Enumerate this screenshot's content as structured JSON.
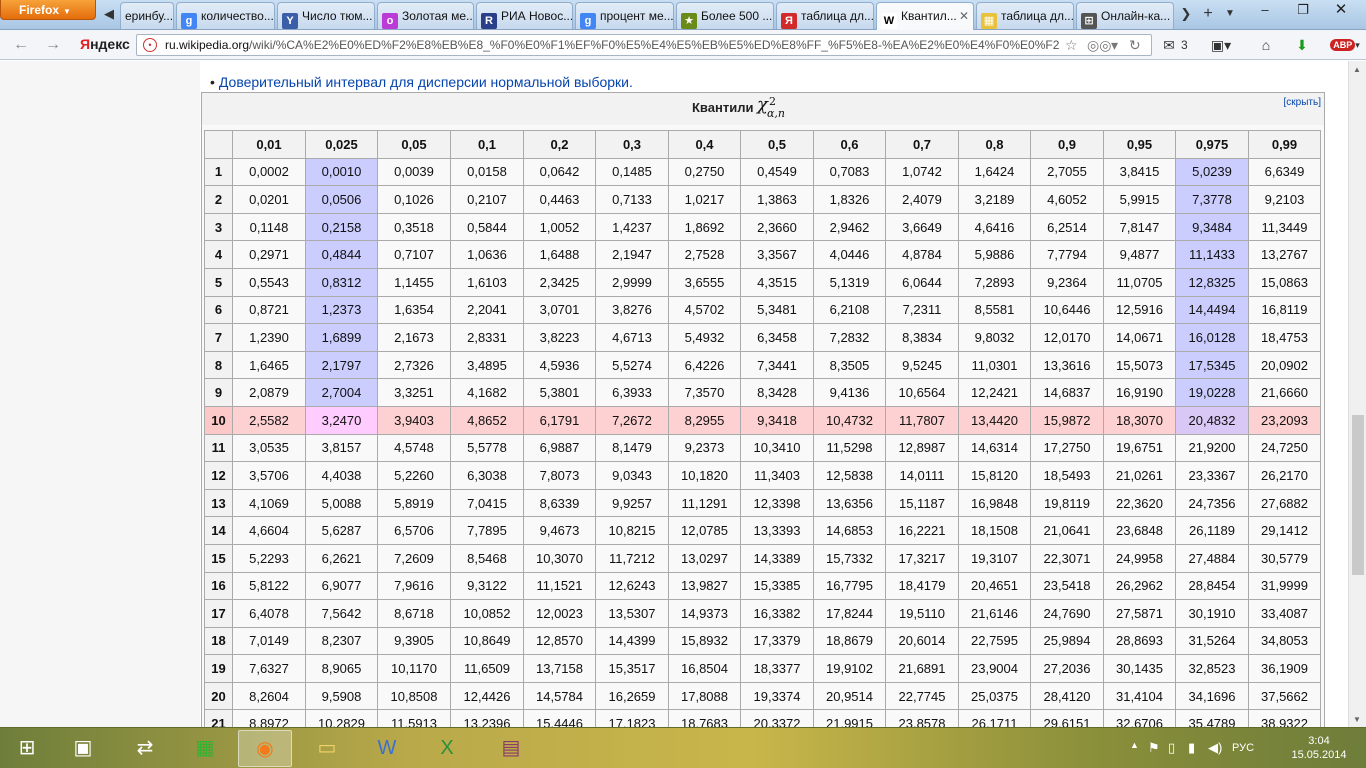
{
  "browser": {
    "menu_button": "Firefox",
    "tabs": [
      {
        "label": "еринбу...",
        "icon": ""
      },
      {
        "label": "количество...",
        "icon": "g"
      },
      {
        "label": "Число тюм...",
        "icon": "Y"
      },
      {
        "label": "Золотая ме...",
        "icon": "o"
      },
      {
        "label": "РИА Новос...",
        "icon": "R"
      },
      {
        "label": "процент ме...",
        "icon": "g"
      },
      {
        "label": "Более 500 ...",
        "icon": "★"
      },
      {
        "label": "таблица дл...",
        "icon": "Я"
      },
      {
        "label": "Квантил...",
        "icon": "W"
      },
      {
        "label": "таблица дл...",
        "icon": "▦"
      },
      {
        "label": "Онлайн-ка...",
        "icon": "⊞"
      }
    ],
    "yandex_label": "Яндекс",
    "yandex_first_letter": "Я",
    "yandex_rest": "ндекс",
    "url_host": "ru.wikipedia.org",
    "url_path": "/wiki/%CA%E2%E0%ED%F2%E8%EB%E8_%F0%E0%F1%EF%F0%E5%E4%E5%EB%E5%ED%E8%FF_%F5%E8-%EA%E2%E0%E4%F0%E0%F2",
    "mail_count": "3",
    "abp_label": "ABP"
  },
  "page": {
    "bullet_link": "Доверительный интервал для дисперсии нормальной выборки.",
    "table_title": "Квантили",
    "formula_base": "χ",
    "formula_sup": "2",
    "formula_sub": "α,n",
    "hide_link": "[скрыть]",
    "columns": [
      "0,01",
      "0,025",
      "0,05",
      "0,1",
      "0,2",
      "0,3",
      "0,4",
      "0,5",
      "0,6",
      "0,7",
      "0,8",
      "0,9",
      "0,95",
      "0,975",
      "0,99"
    ],
    "rows": [
      {
        "n": "1",
        "values": [
          "0,0002",
          "0,0010",
          "0,0039",
          "0,0158",
          "0,0642",
          "0,1485",
          "0,2750",
          "0,4549",
          "0,7083",
          "1,0742",
          "1,6424",
          "2,7055",
          "3,8415",
          "5,0239",
          "6,6349"
        ]
      },
      {
        "n": "2",
        "values": [
          "0,0201",
          "0,0506",
          "0,1026",
          "0,2107",
          "0,4463",
          "0,7133",
          "1,0217",
          "1,3863",
          "1,8326",
          "2,4079",
          "3,2189",
          "4,6052",
          "5,9915",
          "7,3778",
          "9,2103"
        ]
      },
      {
        "n": "3",
        "values": [
          "0,1148",
          "0,2158",
          "0,3518",
          "0,5844",
          "1,0052",
          "1,4237",
          "1,8692",
          "2,3660",
          "2,9462",
          "3,6649",
          "4,6416",
          "6,2514",
          "7,8147",
          "9,3484",
          "11,3449"
        ]
      },
      {
        "n": "4",
        "values": [
          "0,2971",
          "0,4844",
          "0,7107",
          "1,0636",
          "1,6488",
          "2,1947",
          "2,7528",
          "3,3567",
          "4,0446",
          "4,8784",
          "5,9886",
          "7,7794",
          "9,4877",
          "11,1433",
          "13,2767"
        ]
      },
      {
        "n": "5",
        "values": [
          "0,5543",
          "0,8312",
          "1,1455",
          "1,6103",
          "2,3425",
          "2,9999",
          "3,6555",
          "4,3515",
          "5,1319",
          "6,0644",
          "7,2893",
          "9,2364",
          "11,0705",
          "12,8325",
          "15,0863"
        ]
      },
      {
        "n": "6",
        "values": [
          "0,8721",
          "1,2373",
          "1,6354",
          "2,2041",
          "3,0701",
          "3,8276",
          "4,5702",
          "5,3481",
          "6,2108",
          "7,2311",
          "8,5581",
          "10,6446",
          "12,5916",
          "14,4494",
          "16,8119"
        ]
      },
      {
        "n": "7",
        "values": [
          "1,2390",
          "1,6899",
          "2,1673",
          "2,8331",
          "3,8223",
          "4,6713",
          "5,4932",
          "6,3458",
          "7,2832",
          "8,3834",
          "9,8032",
          "12,0170",
          "14,0671",
          "16,0128",
          "18,4753"
        ]
      },
      {
        "n": "8",
        "values": [
          "1,6465",
          "2,1797",
          "2,7326",
          "3,4895",
          "4,5936",
          "5,5274",
          "6,4226",
          "7,3441",
          "8,3505",
          "9,5245",
          "11,0301",
          "13,3616",
          "15,5073",
          "17,5345",
          "20,0902"
        ]
      },
      {
        "n": "9",
        "values": [
          "2,0879",
          "2,7004",
          "3,3251",
          "4,1682",
          "5,3801",
          "6,3933",
          "7,3570",
          "8,3428",
          "9,4136",
          "10,6564",
          "12,2421",
          "14,6837",
          "16,9190",
          "19,0228",
          "21,6660"
        ]
      },
      {
        "n": "10",
        "values": [
          "2,5582",
          "3,2470",
          "3,9403",
          "4,8652",
          "6,1791",
          "7,2672",
          "8,2955",
          "9,3418",
          "10,4732",
          "11,7807",
          "13,4420",
          "15,9872",
          "18,3070",
          "20,4832",
          "23,2093"
        ]
      },
      {
        "n": "11",
        "values": [
          "3,0535",
          "3,8157",
          "4,5748",
          "5,5778",
          "6,9887",
          "8,1479",
          "9,2373",
          "10,3410",
          "11,5298",
          "12,8987",
          "14,6314",
          "17,2750",
          "19,6751",
          "21,9200",
          "24,7250"
        ]
      },
      {
        "n": "12",
        "values": [
          "3,5706",
          "4,4038",
          "5,2260",
          "6,3038",
          "7,8073",
          "9,0343",
          "10,1820",
          "11,3403",
          "12,5838",
          "14,0111",
          "15,8120",
          "18,5493",
          "21,0261",
          "23,3367",
          "26,2170"
        ]
      },
      {
        "n": "13",
        "values": [
          "4,1069",
          "5,0088",
          "5,8919",
          "7,0415",
          "8,6339",
          "9,9257",
          "11,1291",
          "12,3398",
          "13,6356",
          "15,1187",
          "16,9848",
          "19,8119",
          "22,3620",
          "24,7356",
          "27,6882"
        ]
      },
      {
        "n": "14",
        "values": [
          "4,6604",
          "5,6287",
          "6,5706",
          "7,7895",
          "9,4673",
          "10,8215",
          "12,0785",
          "13,3393",
          "14,6853",
          "16,2221",
          "18,1508",
          "21,0641",
          "23,6848",
          "26,1189",
          "29,1412"
        ]
      },
      {
        "n": "15",
        "values": [
          "5,2293",
          "6,2621",
          "7,2609",
          "8,5468",
          "10,3070",
          "11,7212",
          "13,0297",
          "14,3389",
          "15,7332",
          "17,3217",
          "19,3107",
          "22,3071",
          "24,9958",
          "27,4884",
          "30,5779"
        ]
      },
      {
        "n": "16",
        "values": [
          "5,8122",
          "6,9077",
          "7,9616",
          "9,3122",
          "11,1521",
          "12,6243",
          "13,9827",
          "15,3385",
          "16,7795",
          "18,4179",
          "20,4651",
          "23,5418",
          "26,2962",
          "28,8454",
          "31,9999"
        ]
      },
      {
        "n": "17",
        "values": [
          "6,4078",
          "7,5642",
          "8,6718",
          "10,0852",
          "12,0023",
          "13,5307",
          "14,9373",
          "16,3382",
          "17,8244",
          "19,5110",
          "21,6146",
          "24,7690",
          "27,5871",
          "30,1910",
          "33,4087"
        ]
      },
      {
        "n": "18",
        "values": [
          "7,0149",
          "8,2307",
          "9,3905",
          "10,8649",
          "12,8570",
          "14,4399",
          "15,8932",
          "17,3379",
          "18,8679",
          "20,6014",
          "22,7595",
          "25,9894",
          "28,8693",
          "31,5264",
          "34,8053"
        ]
      },
      {
        "n": "19",
        "values": [
          "7,6327",
          "8,9065",
          "10,1170",
          "11,6509",
          "13,7158",
          "15,3517",
          "16,8504",
          "18,3377",
          "19,9102",
          "21,6891",
          "23,9004",
          "27,2036",
          "30,1435",
          "32,8523",
          "36,1909"
        ]
      },
      {
        "n": "20",
        "values": [
          "8,2604",
          "9,5908",
          "10,8508",
          "12,4426",
          "14,5784",
          "16,2659",
          "17,8088",
          "19,3374",
          "20,9514",
          "22,7745",
          "25,0375",
          "28,4120",
          "31,4104",
          "34,1696",
          "37,5662"
        ]
      },
      {
        "n": "21",
        "values": [
          "8,8972",
          "10,2829",
          "11,5913",
          "13,2396",
          "15,4446",
          "17,1823",
          "18,7683",
          "20,3372",
          "21,9915",
          "23,8578",
          "26,1711",
          "29,6151",
          "32,6706",
          "35,4789",
          "38,9322"
        ]
      }
    ],
    "highlight_row_index": 9,
    "highlight_column_indices": [
      1,
      13
    ],
    "colors": {
      "column_highlight": "#cbcdff",
      "row_highlight": "#fdd1d1",
      "intersection_highlight": "#ffccff"
    }
  },
  "taskbar": {
    "apps": [
      "windows-start",
      "cmd-app",
      "network-app",
      "store-app",
      "firefox-app",
      "explorer-app",
      "word-app",
      "excel-app",
      "winrar-app"
    ],
    "active_app": "firefox-app",
    "lang": "РУС",
    "time": "3:04",
    "date": "15.05.2014"
  }
}
